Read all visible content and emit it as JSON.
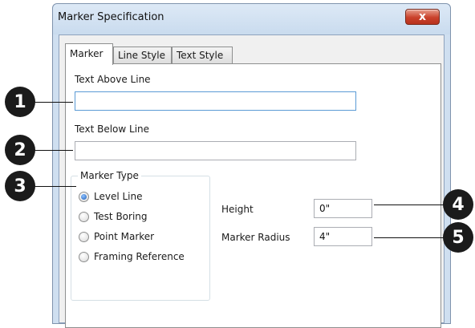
{
  "window": {
    "title": "Marker Specification",
    "close_glyph": "x"
  },
  "tabs": [
    {
      "label": "Marker",
      "active": true
    },
    {
      "label": "Line Style",
      "active": false
    },
    {
      "label": "Text Style",
      "active": false
    }
  ],
  "fields": {
    "text_above_label": "Text Above Line",
    "text_above_value": "",
    "text_below_label": "Text Below Line",
    "text_below_value": ""
  },
  "marker_type": {
    "title": "Marker Type",
    "options": [
      {
        "label": "Level Line",
        "checked": true
      },
      {
        "label": "Test Boring",
        "checked": false
      },
      {
        "label": "Point Marker",
        "checked": false
      },
      {
        "label": "Framing Reference",
        "checked": false
      }
    ]
  },
  "dimensions": {
    "height_label": "Height",
    "height_value": "0\"",
    "radius_label": "Marker Radius",
    "radius_value": "4\""
  },
  "callouts": [
    "1",
    "2",
    "3",
    "4",
    "5"
  ]
}
